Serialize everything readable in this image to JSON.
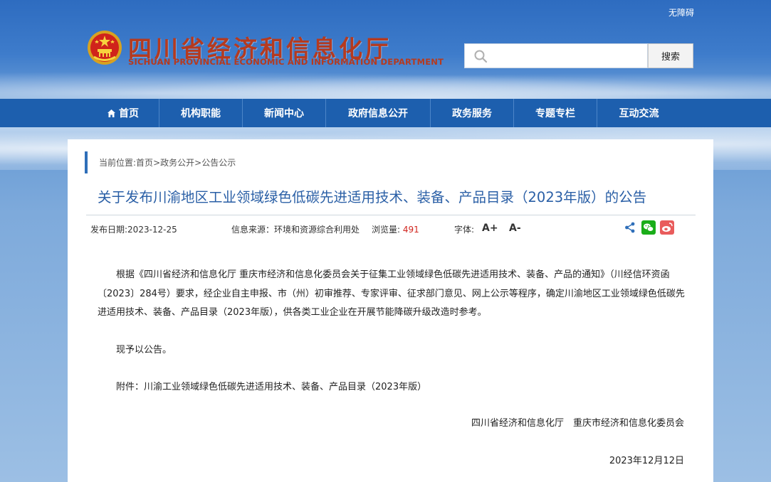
{
  "header": {
    "accessibility": "无障碍",
    "site_title": "四川省经济和信息化厅",
    "site_subtitle": "SICHUAN PROVINCIAL ECONOMIC AND INFORMATION DEPARTMENT",
    "search_placeholder": "",
    "search_button": "搜索",
    "emblem_icon": "national-emblem-icon"
  },
  "nav": {
    "items": [
      {
        "label": "首页",
        "icon": "home-icon"
      },
      {
        "label": "机构职能"
      },
      {
        "label": "新闻中心"
      },
      {
        "label": "政府信息公开"
      },
      {
        "label": "政务服务"
      },
      {
        "label": "专题专栏"
      },
      {
        "label": "互动交流"
      }
    ]
  },
  "breadcrumb": {
    "prefix": "当前位置:",
    "items": [
      "首页",
      "政务公开",
      "公告公示"
    ],
    "separator": ">"
  },
  "article": {
    "title": "关于发布川渝地区工业领域绿色低碳先进适用技术、装备、产品目录（2023年版）的公告",
    "meta": {
      "date_label": "发布日期:",
      "date": "2023-12-25",
      "source_label": "信息来源：",
      "source": "环境和资源综合利用处",
      "views_label": "浏览量:",
      "views": "491",
      "font_label": "字体:",
      "font_increase": "A+",
      "font_decrease": "A-"
    },
    "paragraphs": [
      "根据《四川省经济和信息化厅 重庆市经济和信息化委员会关于征集工业领域绿色低碳先进适用技术、装备、产品的通知》（川经信环资函〔2023〕284号）要求，经企业自主申报、市（州）初审推荐、专家评审、征求部门意见、网上公示等程序，确定川渝地区工业领域绿色低碳先进适用技术、装备、产品目录（2023年版），供各类工业企业在开展节能降碳升级改造时参考。",
      "现予以公告。",
      "附件：川渝工业领域绿色低碳先进适用技术、装备、产品目录（2023年版）"
    ],
    "signature": "四川省经济和信息化厅　重庆市经济和信息化委员会",
    "sign_date": "2023年12月12日"
  },
  "share": [
    "share-icon",
    "wechat-icon",
    "weibo-icon"
  ],
  "colors": {
    "nav_bg": "#1d5fae",
    "title": "#2a5fa6",
    "brand_red": "#b53a1f",
    "views": "#d1261f",
    "wechat": "#1aad19",
    "weibo": "#e6162d"
  }
}
